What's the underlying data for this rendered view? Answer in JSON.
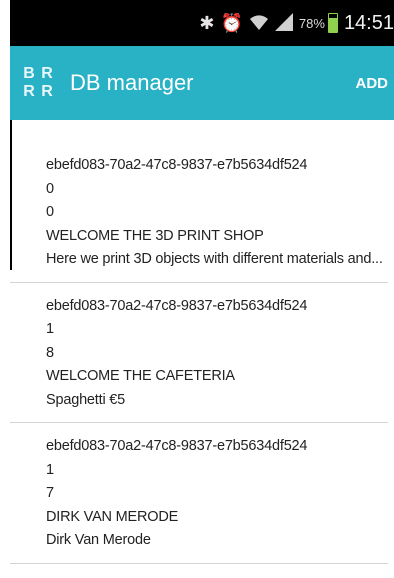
{
  "status_bar": {
    "icons": [
      "bluetooth-icon",
      "alarm-icon",
      "wifi-icon",
      "signal-icon"
    ],
    "battery_percent": "78%",
    "battery_level": 0.78,
    "time": "14:51"
  },
  "app_bar": {
    "logo_letters": [
      "B",
      "R",
      "R",
      "R"
    ],
    "title": "DB manager",
    "add_label": "ADD",
    "background_color": "#29b1c6"
  },
  "items": [
    {
      "id": "ebefd083-70a2-47c8-9837-e7b5634df524",
      "field1": "0",
      "field2": "0",
      "title": "WELCOME THE 3D PRINT SHOP",
      "description": "Here we print 3D objects with different materials and..."
    },
    {
      "id": "ebefd083-70a2-47c8-9837-e7b5634df524",
      "field1": "1",
      "field2": "8",
      "title": "WELCOME THE CAFETERIA",
      "description": "Spaghetti €5"
    },
    {
      "id": "ebefd083-70a2-47c8-9837-e7b5634df524",
      "field1": "1",
      "field2": "7",
      "title": "DIRK VAN MERODE",
      "description": "Dirk Van Merode"
    }
  ]
}
